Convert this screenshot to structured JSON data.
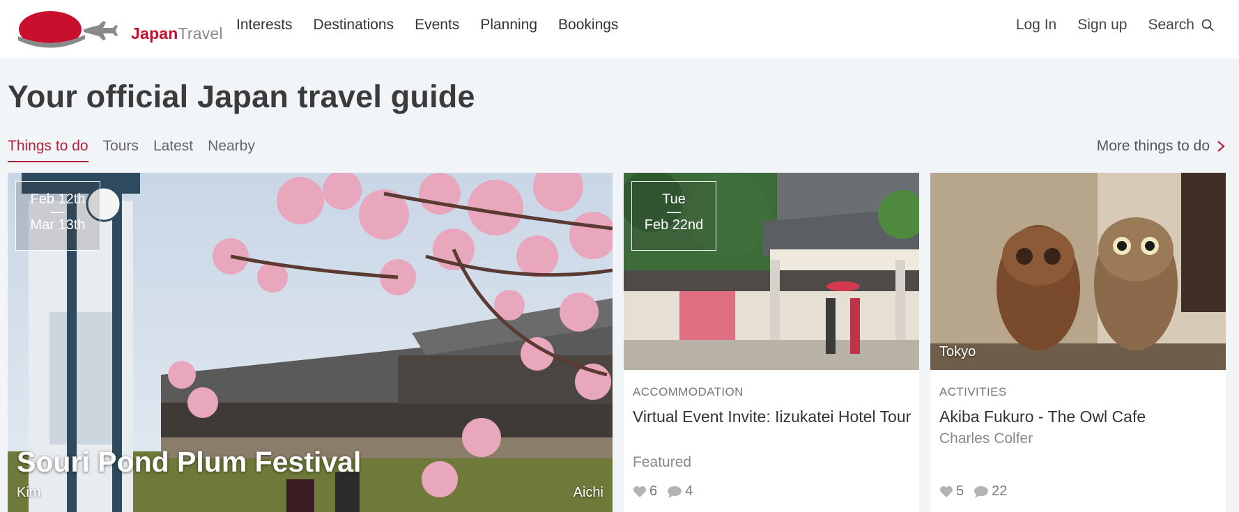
{
  "brand": {
    "part1": "Japan",
    "part2": "Travel"
  },
  "nav": [
    "Interests",
    "Destinations",
    "Events",
    "Planning",
    "Bookings"
  ],
  "account": {
    "login": "Log In",
    "signup": "Sign up",
    "search": "Search"
  },
  "page_title": "Your official Japan travel guide",
  "tabs": [
    "Things to do",
    "Tours",
    "Latest",
    "Nearby"
  ],
  "more_link": "More things to do",
  "featured": {
    "date_start": "Feb 12th",
    "date_end": "Mar 13th",
    "title": "Souri Pond Plum Festival",
    "author": "Kim",
    "location": "Aichi"
  },
  "cards": [
    {
      "date_day": "Tue",
      "date": "Feb 22nd",
      "category": "ACCOMMODATION",
      "title": "Virtual Event Invite: Iizukatei Hotel Tour",
      "subtitle": "Featured",
      "likes": "6",
      "comments": "4"
    },
    {
      "location": "Tokyo",
      "category": "ACTIVITIES",
      "title": "Akiba Fukuro - The Owl Cafe",
      "subtitle": "Charles Colfer",
      "likes": "5",
      "comments": "22"
    }
  ],
  "colors": {
    "brand_red": "#c8102e",
    "tab_active": "#b5203a",
    "background": "#f2f5f8"
  }
}
